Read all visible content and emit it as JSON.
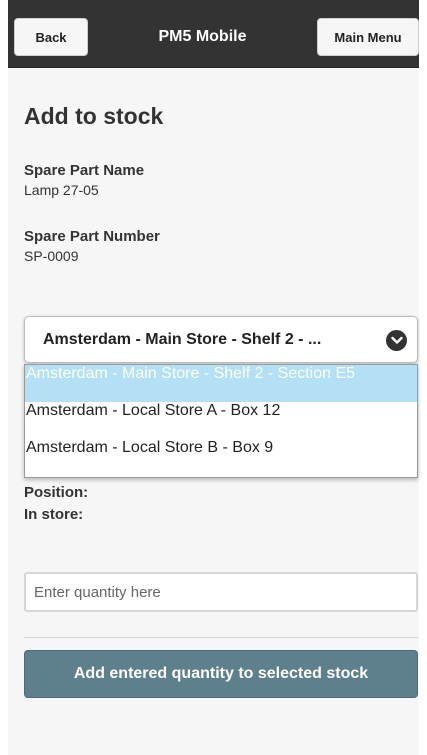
{
  "header": {
    "back_label": "Back",
    "title": "PM5 Mobile",
    "main_menu_label": "Main Menu"
  },
  "page": {
    "title": "Add to stock"
  },
  "spare_part": {
    "name_label": "Spare Part Name",
    "name_value": "Lamp 27-05",
    "number_label": "Spare Part Number",
    "number_value": "SP-0009"
  },
  "location_select": {
    "selected_display": "Amsterdam - Main Store - Shelf 2 - ...",
    "options": [
      "Amsterdam - Main Store - Shelf 2 - Section E5",
      "Amsterdam - Local Store A - Box 12",
      "Amsterdam - Local Store B - Box 9"
    ]
  },
  "details": {
    "position_label": "Position:",
    "in_store_label": "In store:"
  },
  "quantity": {
    "placeholder": "Enter quantity here",
    "value": ""
  },
  "actions": {
    "add_label": "Add entered quantity to selected stock"
  },
  "colors": {
    "header_bg": "#333333",
    "button_accent": "#5e7f8c",
    "selected_option_bg": "#b3e0f5"
  },
  "icons": {
    "select_arrow": "chevron-down-icon"
  }
}
